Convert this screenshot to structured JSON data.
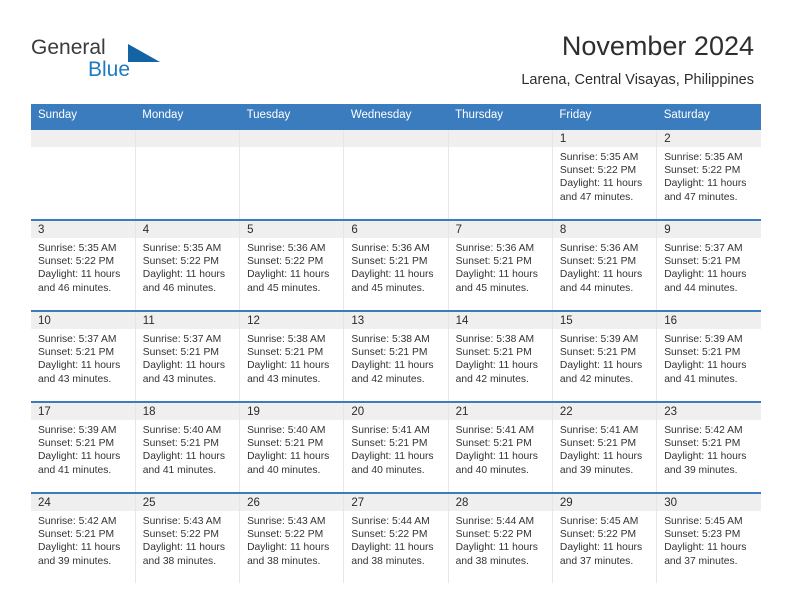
{
  "brand": {
    "name_part1": "General",
    "name_part2": "Blue"
  },
  "header": {
    "title": "November 2024",
    "location": "Larena, Central Visayas, Philippines"
  },
  "weekday_headers": [
    "Sunday",
    "Monday",
    "Tuesday",
    "Wednesday",
    "Thursday",
    "Friday",
    "Saturday"
  ],
  "colors": {
    "header_blue": "#3a7cbe",
    "daynum_band": "#efefef",
    "brand_blue": "#1f7bc1",
    "brand_triangle": "#1464a5",
    "text": "#333333"
  },
  "weeks": [
    [
      {
        "empty": true
      },
      {
        "empty": true
      },
      {
        "empty": true
      },
      {
        "empty": true
      },
      {
        "empty": true
      },
      {
        "day": "1",
        "sunrise": "Sunrise: 5:35 AM",
        "sunset": "Sunset: 5:22 PM",
        "daylight1": "Daylight: 11 hours",
        "daylight2": "and 47 minutes."
      },
      {
        "day": "2",
        "sunrise": "Sunrise: 5:35 AM",
        "sunset": "Sunset: 5:22 PM",
        "daylight1": "Daylight: 11 hours",
        "daylight2": "and 47 minutes."
      }
    ],
    [
      {
        "day": "3",
        "sunrise": "Sunrise: 5:35 AM",
        "sunset": "Sunset: 5:22 PM",
        "daylight1": "Daylight: 11 hours",
        "daylight2": "and 46 minutes."
      },
      {
        "day": "4",
        "sunrise": "Sunrise: 5:35 AM",
        "sunset": "Sunset: 5:22 PM",
        "daylight1": "Daylight: 11 hours",
        "daylight2": "and 46 minutes."
      },
      {
        "day": "5",
        "sunrise": "Sunrise: 5:36 AM",
        "sunset": "Sunset: 5:22 PM",
        "daylight1": "Daylight: 11 hours",
        "daylight2": "and 45 minutes."
      },
      {
        "day": "6",
        "sunrise": "Sunrise: 5:36 AM",
        "sunset": "Sunset: 5:21 PM",
        "daylight1": "Daylight: 11 hours",
        "daylight2": "and 45 minutes."
      },
      {
        "day": "7",
        "sunrise": "Sunrise: 5:36 AM",
        "sunset": "Sunset: 5:21 PM",
        "daylight1": "Daylight: 11 hours",
        "daylight2": "and 45 minutes."
      },
      {
        "day": "8",
        "sunrise": "Sunrise: 5:36 AM",
        "sunset": "Sunset: 5:21 PM",
        "daylight1": "Daylight: 11 hours",
        "daylight2": "and 44 minutes."
      },
      {
        "day": "9",
        "sunrise": "Sunrise: 5:37 AM",
        "sunset": "Sunset: 5:21 PM",
        "daylight1": "Daylight: 11 hours",
        "daylight2": "and 44 minutes."
      }
    ],
    [
      {
        "day": "10",
        "sunrise": "Sunrise: 5:37 AM",
        "sunset": "Sunset: 5:21 PM",
        "daylight1": "Daylight: 11 hours",
        "daylight2": "and 43 minutes."
      },
      {
        "day": "11",
        "sunrise": "Sunrise: 5:37 AM",
        "sunset": "Sunset: 5:21 PM",
        "daylight1": "Daylight: 11 hours",
        "daylight2": "and 43 minutes."
      },
      {
        "day": "12",
        "sunrise": "Sunrise: 5:38 AM",
        "sunset": "Sunset: 5:21 PM",
        "daylight1": "Daylight: 11 hours",
        "daylight2": "and 43 minutes."
      },
      {
        "day": "13",
        "sunrise": "Sunrise: 5:38 AM",
        "sunset": "Sunset: 5:21 PM",
        "daylight1": "Daylight: 11 hours",
        "daylight2": "and 42 minutes."
      },
      {
        "day": "14",
        "sunrise": "Sunrise: 5:38 AM",
        "sunset": "Sunset: 5:21 PM",
        "daylight1": "Daylight: 11 hours",
        "daylight2": "and 42 minutes."
      },
      {
        "day": "15",
        "sunrise": "Sunrise: 5:39 AM",
        "sunset": "Sunset: 5:21 PM",
        "daylight1": "Daylight: 11 hours",
        "daylight2": "and 42 minutes."
      },
      {
        "day": "16",
        "sunrise": "Sunrise: 5:39 AM",
        "sunset": "Sunset: 5:21 PM",
        "daylight1": "Daylight: 11 hours",
        "daylight2": "and 41 minutes."
      }
    ],
    [
      {
        "day": "17",
        "sunrise": "Sunrise: 5:39 AM",
        "sunset": "Sunset: 5:21 PM",
        "daylight1": "Daylight: 11 hours",
        "daylight2": "and 41 minutes."
      },
      {
        "day": "18",
        "sunrise": "Sunrise: 5:40 AM",
        "sunset": "Sunset: 5:21 PM",
        "daylight1": "Daylight: 11 hours",
        "daylight2": "and 41 minutes."
      },
      {
        "day": "19",
        "sunrise": "Sunrise: 5:40 AM",
        "sunset": "Sunset: 5:21 PM",
        "daylight1": "Daylight: 11 hours",
        "daylight2": "and 40 minutes."
      },
      {
        "day": "20",
        "sunrise": "Sunrise: 5:41 AM",
        "sunset": "Sunset: 5:21 PM",
        "daylight1": "Daylight: 11 hours",
        "daylight2": "and 40 minutes."
      },
      {
        "day": "21",
        "sunrise": "Sunrise: 5:41 AM",
        "sunset": "Sunset: 5:21 PM",
        "daylight1": "Daylight: 11 hours",
        "daylight2": "and 40 minutes."
      },
      {
        "day": "22",
        "sunrise": "Sunrise: 5:41 AM",
        "sunset": "Sunset: 5:21 PM",
        "daylight1": "Daylight: 11 hours",
        "daylight2": "and 39 minutes."
      },
      {
        "day": "23",
        "sunrise": "Sunrise: 5:42 AM",
        "sunset": "Sunset: 5:21 PM",
        "daylight1": "Daylight: 11 hours",
        "daylight2": "and 39 minutes."
      }
    ],
    [
      {
        "day": "24",
        "sunrise": "Sunrise: 5:42 AM",
        "sunset": "Sunset: 5:21 PM",
        "daylight1": "Daylight: 11 hours",
        "daylight2": "and 39 minutes."
      },
      {
        "day": "25",
        "sunrise": "Sunrise: 5:43 AM",
        "sunset": "Sunset: 5:22 PM",
        "daylight1": "Daylight: 11 hours",
        "daylight2": "and 38 minutes."
      },
      {
        "day": "26",
        "sunrise": "Sunrise: 5:43 AM",
        "sunset": "Sunset: 5:22 PM",
        "daylight1": "Daylight: 11 hours",
        "daylight2": "and 38 minutes."
      },
      {
        "day": "27",
        "sunrise": "Sunrise: 5:44 AM",
        "sunset": "Sunset: 5:22 PM",
        "daylight1": "Daylight: 11 hours",
        "daylight2": "and 38 minutes."
      },
      {
        "day": "28",
        "sunrise": "Sunrise: 5:44 AM",
        "sunset": "Sunset: 5:22 PM",
        "daylight1": "Daylight: 11 hours",
        "daylight2": "and 38 minutes."
      },
      {
        "day": "29",
        "sunrise": "Sunrise: 5:45 AM",
        "sunset": "Sunset: 5:22 PM",
        "daylight1": "Daylight: 11 hours",
        "daylight2": "and 37 minutes."
      },
      {
        "day": "30",
        "sunrise": "Sunrise: 5:45 AM",
        "sunset": "Sunset: 5:23 PM",
        "daylight1": "Daylight: 11 hours",
        "daylight2": "and 37 minutes."
      }
    ]
  ]
}
